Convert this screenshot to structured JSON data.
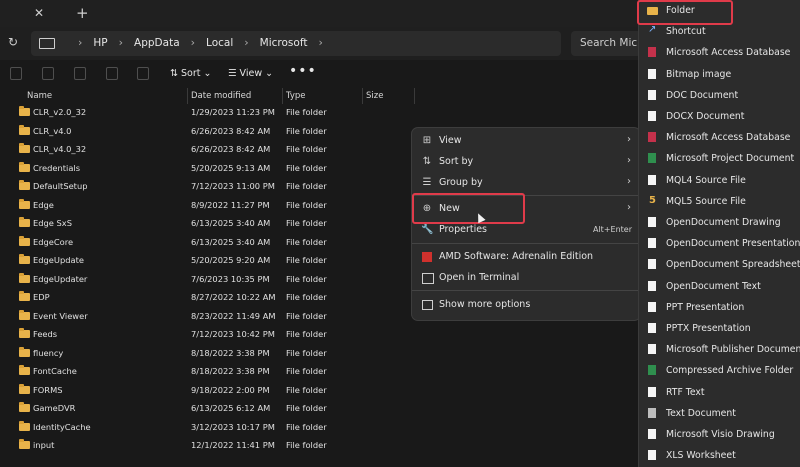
{
  "tabstrip": {
    "close_glyph": "✕",
    "add_glyph": "+"
  },
  "address": {
    "crumbs": [
      "HP",
      "AppData",
      "Local",
      "Microsoft"
    ],
    "search_placeholder": "Search Micros"
  },
  "toolbar": {
    "sort_label": "Sort",
    "view_label": "View",
    "more_glyph": "•••"
  },
  "columns": {
    "name": "Name",
    "date": "Date modified",
    "type": "Type",
    "size": "Size"
  },
  "files": [
    {
      "name": "CLR_v2.0_32",
      "date": "1/29/2023 11:23 PM",
      "type": "File folder"
    },
    {
      "name": "CLR_v4.0",
      "date": "6/26/2023 8:42 AM",
      "type": "File folder"
    },
    {
      "name": "CLR_v4.0_32",
      "date": "6/26/2023 8:42 AM",
      "type": "File folder"
    },
    {
      "name": "Credentials",
      "date": "5/20/2025 9:13 AM",
      "type": "File folder"
    },
    {
      "name": "DefaultSetup",
      "date": "7/12/2023 11:00 PM",
      "type": "File folder"
    },
    {
      "name": "Edge",
      "date": "8/9/2022 11:27 PM",
      "type": "File folder"
    },
    {
      "name": "Edge SxS",
      "date": "6/13/2025 3:40 AM",
      "type": "File folder"
    },
    {
      "name": "EdgeCore",
      "date": "6/13/2025 3:40 AM",
      "type": "File folder"
    },
    {
      "name": "EdgeUpdate",
      "date": "5/20/2025 9:20 AM",
      "type": "File folder"
    },
    {
      "name": "EdgeUpdater",
      "date": "7/6/2023 10:35 PM",
      "type": "File folder"
    },
    {
      "name": "EDP",
      "date": "8/27/2022 10:22 AM",
      "type": "File folder"
    },
    {
      "name": "Event Viewer",
      "date": "8/23/2022 11:49 AM",
      "type": "File folder"
    },
    {
      "name": "Feeds",
      "date": "7/12/2023 10:42 PM",
      "type": "File folder"
    },
    {
      "name": "fluency",
      "date": "8/18/2022 3:38 PM",
      "type": "File folder"
    },
    {
      "name": "FontCache",
      "date": "8/18/2022 3:38 PM",
      "type": "File folder"
    },
    {
      "name": "FORMS",
      "date": "9/18/2022 2:00 PM",
      "type": "File folder"
    },
    {
      "name": "GameDVR",
      "date": "6/13/2025 6:12 AM",
      "type": "File folder"
    },
    {
      "name": "IdentityCache",
      "date": "3/12/2023 10:17 PM",
      "type": "File folder"
    },
    {
      "name": "input",
      "date": "12/1/2022 11:41 PM",
      "type": "File folder"
    }
  ],
  "context_menu": {
    "view": "View",
    "sort_by": "Sort by",
    "group_by": "Group by",
    "new": "New",
    "properties": "Properties",
    "properties_shortcut": "Alt+Enter",
    "amd": "AMD Software: Adrenalin Edition",
    "terminal": "Open in Terminal",
    "more_options": "Show more options"
  },
  "new_submenu": [
    "Folder",
    "Shortcut",
    "Microsoft Access Database",
    "Bitmap image",
    "DOC Document",
    "DOCX Document",
    "Microsoft Access Database",
    "Microsoft Project Document",
    "MQL4 Source File",
    "MQL5 Source File",
    "OpenDocument Drawing",
    "OpenDocument Presentation",
    "OpenDocument Spreadsheet",
    "OpenDocument Text",
    "PPT Presentation",
    "PPTX Presentation",
    "Microsoft Publisher Document",
    "Compressed Archive Folder",
    "RTF Text",
    "Text Document",
    "Microsoft Visio Drawing",
    "XLS Worksheet"
  ],
  "colors": {
    "highlight": "#e03b4a",
    "folder": "#e8b34a",
    "menu_bg": "#2c2c2c"
  }
}
